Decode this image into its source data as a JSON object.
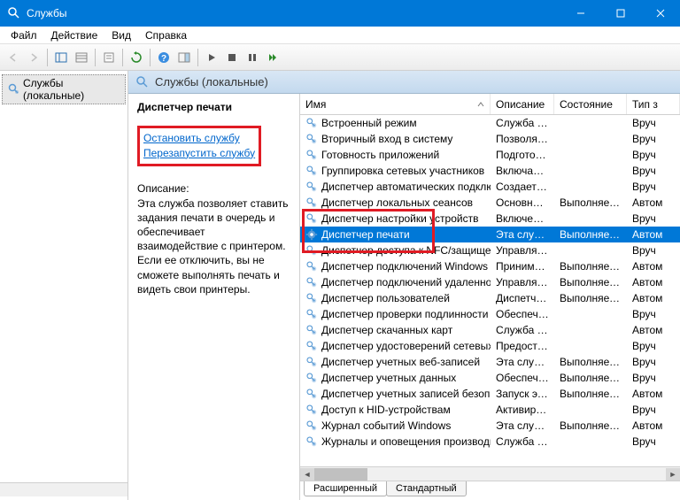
{
  "window": {
    "title": "Службы"
  },
  "menu": {
    "file": "Файл",
    "action": "Действие",
    "view": "Вид",
    "help": "Справка"
  },
  "tree": {
    "root": "Службы (локальные)"
  },
  "pane": {
    "header": "Службы (локальные)"
  },
  "detail": {
    "name": "Диспетчер печати",
    "stop": "Остановить",
    "restart": "Перезапустить",
    "suffix": " службу",
    "desc_label": "Описание:",
    "desc": "Эта служба позволяет ставить задания печати в очередь и обеспечивает взаимодействие с принтером. Если ее отключить, вы не сможете выполнять печать и видеть свои принтеры."
  },
  "cols": {
    "name": "Имя",
    "desc": "Описание",
    "state": "Состояние",
    "type": "Тип з"
  },
  "tabs": {
    "ext": "Расширенный",
    "std": "Стандартный"
  },
  "rows": [
    {
      "name": "Встроенный режим",
      "desc": "Служба \"В...",
      "state": "",
      "type": "Вруч"
    },
    {
      "name": "Вторичный вход в систему",
      "desc": "Позволяет...",
      "state": "",
      "type": "Вруч"
    },
    {
      "name": "Готовность приложений",
      "desc": "Подготовк...",
      "state": "",
      "type": "Вруч"
    },
    {
      "name": "Группировка сетевых участников",
      "desc": "Включает ...",
      "state": "",
      "type": "Вруч"
    },
    {
      "name": "Диспетчер автоматических подключ...",
      "desc": "Создает п...",
      "state": "",
      "type": "Вруч"
    },
    {
      "name": "Диспетчер локальных сеансов",
      "desc": "Основная ...",
      "state": "Выполняется",
      "type": "Автом"
    },
    {
      "name": "Диспетчер настройки устройств",
      "desc": "Включени...",
      "state": "",
      "type": "Вруч",
      "covered": true
    },
    {
      "name": "Диспетчер печати",
      "desc": "Эта служб...",
      "state": "Выполняется",
      "type": "Автом",
      "selected": true
    },
    {
      "name": "Диспетчер доступа к NFC/защище...",
      "desc": "Управляет...",
      "state": "",
      "type": "Вруч",
      "covered2": true
    },
    {
      "name": "Диспетчер подключений Windows",
      "desc": "Принимае...",
      "state": "Выполняется",
      "type": "Автом"
    },
    {
      "name": "Диспетчер подключений удаленного...",
      "desc": "Управляет...",
      "state": "Выполняется",
      "type": "Автом"
    },
    {
      "name": "Диспетчер пользователей",
      "desc": "Диспетчер...",
      "state": "Выполняется",
      "type": "Автом"
    },
    {
      "name": "Диспетчер проверки подлинности X...",
      "desc": "Обеспечи...",
      "state": "",
      "type": "Вруч"
    },
    {
      "name": "Диспетчер скачанных карт",
      "desc": "Служба W...",
      "state": "",
      "type": "Автом"
    },
    {
      "name": "Диспетчер удостоверений сетевых уч...",
      "desc": "Предостав...",
      "state": "",
      "type": "Вруч"
    },
    {
      "name": "Диспетчер учетных веб-записей",
      "desc": "Эта служб...",
      "state": "Выполняется",
      "type": "Вруч"
    },
    {
      "name": "Диспетчер учетных данных",
      "desc": "Обеспечи...",
      "state": "Выполняется",
      "type": "Вруч"
    },
    {
      "name": "Диспетчер учетных записей безопасн...",
      "desc": "Запуск это...",
      "state": "Выполняется",
      "type": "Автом"
    },
    {
      "name": "Доступ к HID-устройствам",
      "desc": "Активируе...",
      "state": "",
      "type": "Вруч"
    },
    {
      "name": "Журнал событий Windows",
      "desc": "Эта служб...",
      "state": "Выполняется",
      "type": "Автом"
    },
    {
      "name": "Журналы и оповещения производите...",
      "desc": "Служба ж...",
      "state": "",
      "type": "Вруч"
    }
  ]
}
